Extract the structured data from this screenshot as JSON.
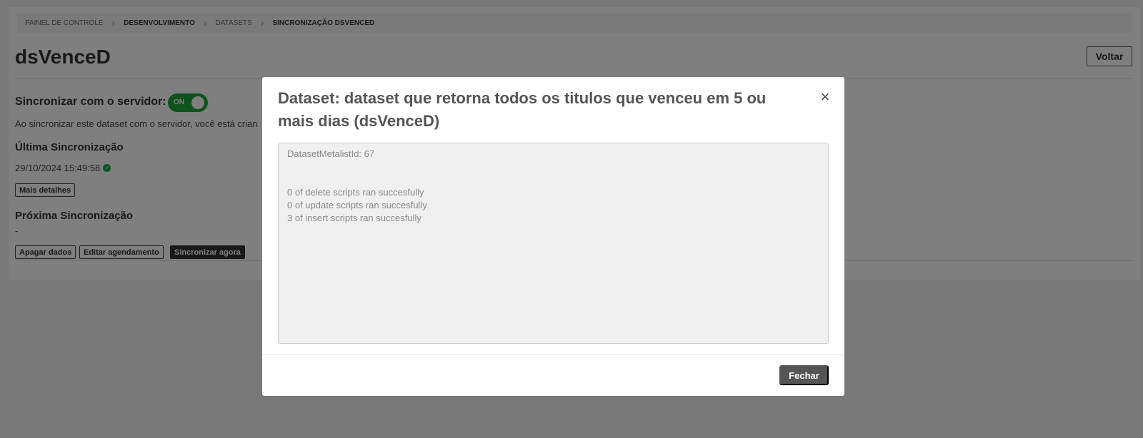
{
  "breadcrumb": {
    "items": [
      "PAINEL DE CONTROLE",
      "DESENVOLVIMENTO",
      "DATASETS",
      "SINCRONIZAÇÃO DSVENCED"
    ]
  },
  "page": {
    "title": "dsVenceD",
    "back_label": "Voltar"
  },
  "sync": {
    "label": "Sincronizar com o servidor:",
    "toggle_text": "ON",
    "toggle_state": "on",
    "description": "Ao sincronizar este dataset com o servidor, você está crian"
  },
  "last_sync": {
    "heading": "Última Sincronização",
    "datetime": "29/10/2024 15:49:58",
    "details_label": "Mais detalhes"
  },
  "next_sync": {
    "heading": "Próxima Sincronização",
    "value": "-"
  },
  "actions": {
    "delete_label": "Apagar dados",
    "edit_schedule_label": "Editar agendamento",
    "sync_now_label": "Sincronizar agora"
  },
  "modal": {
    "title": "Dataset: dataset que retorna todos os titulos que venceu em 5 ou mais dias (dsVenceD)",
    "close_icon": "×",
    "log_id": "DatasetMetalistId: 67",
    "log_lines": [
      "0 of delete scripts ran succesfully",
      "0 of update scripts ran succesfully",
      "3 of insert scripts ran succesfully"
    ],
    "close_label": "Fechar"
  },
  "colors": {
    "toggle_on": "#1fa53a",
    "overlay": "rgba(0,0,0,0.5)",
    "primary_button": "#555555"
  }
}
